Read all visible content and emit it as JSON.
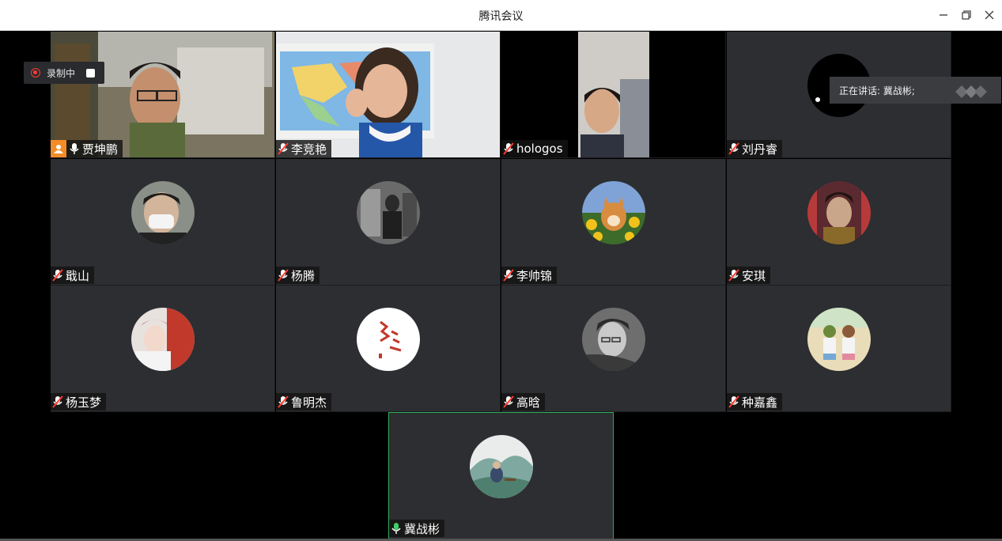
{
  "window": {
    "title": "腾讯会议"
  },
  "recording": {
    "label": "录制中"
  },
  "speaking": {
    "text": "正在讲话: 冀战彬;"
  },
  "participants": [
    {
      "name": "贾坤鹏",
      "kind": "video",
      "icon": "microphone-icon",
      "host": true
    },
    {
      "name": "李竞艳",
      "kind": "video",
      "icon": "microphone-muted-icon"
    },
    {
      "name": "hologos",
      "kind": "video",
      "icon": "microphone-muted-icon"
    },
    {
      "name": "刘丹睿",
      "kind": "avatar",
      "icon": "microphone-muted-icon"
    },
    {
      "name": "戢山",
      "kind": "avatar",
      "icon": "microphone-muted-icon"
    },
    {
      "name": "杨腾",
      "kind": "avatar",
      "icon": "microphone-muted-icon"
    },
    {
      "name": "李帅锦",
      "kind": "avatar",
      "icon": "microphone-muted-icon"
    },
    {
      "name": "安琪",
      "kind": "avatar",
      "icon": "microphone-muted-icon"
    },
    {
      "name": "杨玉梦",
      "kind": "avatar",
      "icon": "microphone-muted-icon"
    },
    {
      "name": "鲁明杰",
      "kind": "avatar",
      "icon": "microphone-muted-icon"
    },
    {
      "name": "高晗",
      "kind": "avatar",
      "icon": "microphone-muted-icon"
    },
    {
      "name": "种嘉鑫",
      "kind": "avatar",
      "icon": "microphone-muted-icon"
    },
    {
      "name": "冀战彬",
      "kind": "avatar",
      "icon": "microphone-icon",
      "active": true
    }
  ],
  "colors": {
    "active_border": "#2fae5a",
    "rec_red": "#ff3b30",
    "host_orange": "#f28c28"
  }
}
